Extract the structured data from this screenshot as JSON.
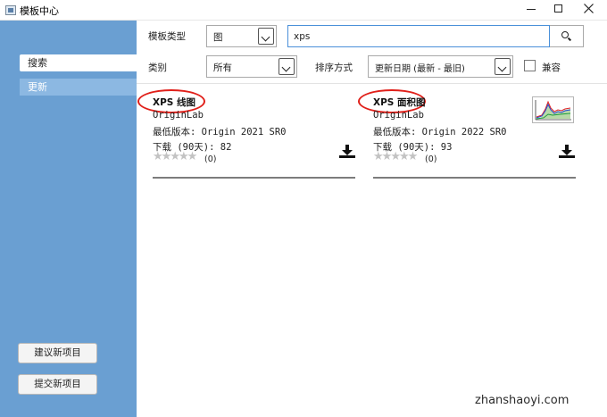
{
  "window": {
    "title": "模板中心"
  },
  "sidebar": {
    "items": [
      {
        "label": "搜索"
      },
      {
        "label": "更新"
      }
    ],
    "buttons": {
      "suggest_label": "建议新项目",
      "submit_label": "提交新项目"
    }
  },
  "filters": {
    "template_type_label": "模板类型",
    "template_type_value": "图",
    "search_value": "xps",
    "category_label": "类别",
    "category_value": "所有",
    "sort_label": "排序方式",
    "sort_value": "更新日期 (最新 - 最旧)",
    "compatible_label": "兼容",
    "compatible_checked": false
  },
  "results": [
    {
      "title": "XPS 线图",
      "author": "OriginLab",
      "min_version": "最低版本: Origin 2021 SR0",
      "downloads": "下载 (90天): 82",
      "rating_stars": 0,
      "rating_count": "(0)",
      "has_thumbnail": false
    },
    {
      "title": "XPS 面积图",
      "author": "OriginLab",
      "min_version": "最低版本: Origin 2022 SR0",
      "downloads": "下载 (90天): 93",
      "rating_stars": 0,
      "rating_count": "(0)",
      "has_thumbnail": true
    }
  ],
  "colors": {
    "sidebar_bg": "#6a9fd2",
    "sidebar_selected": "#8cb8e2",
    "highlight_circle": "#e0201a",
    "search_border": "#4a90d9"
  },
  "icons": {
    "search": "magnifier-icon",
    "download": "download-icon",
    "star": "star-icon"
  },
  "watermark": {
    "text": "zhanshaoyi.com"
  }
}
